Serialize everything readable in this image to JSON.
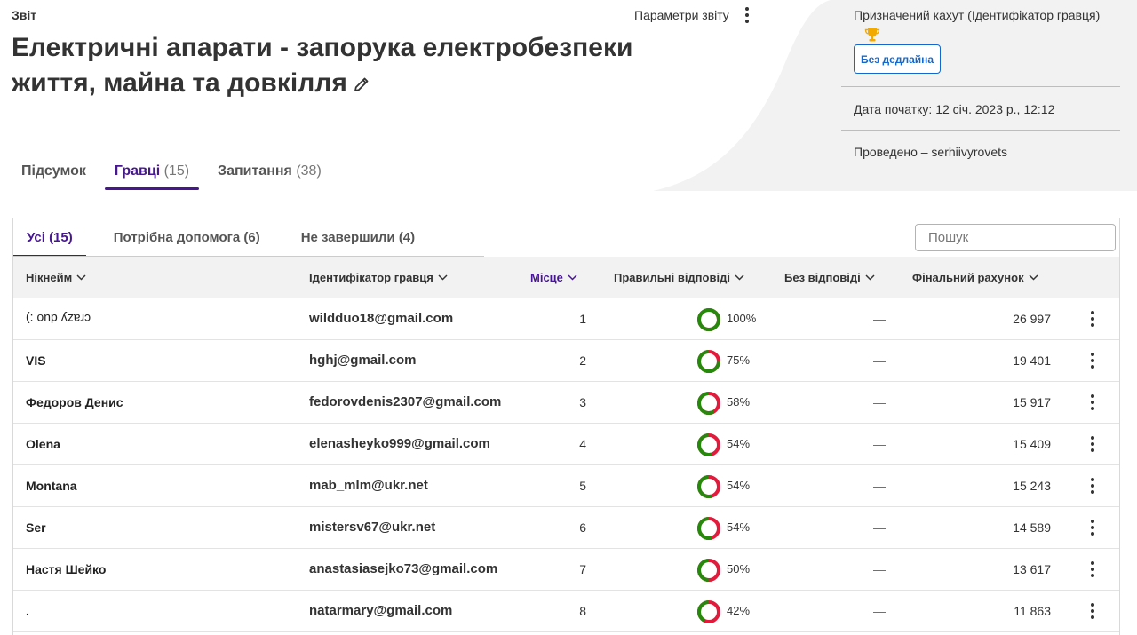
{
  "header": {
    "report_label": "Звіт",
    "title": "Електричні апарати - запорука електробезпеки життя, майна та довкілля",
    "report_options": "Параметри звіту"
  },
  "side_panel": {
    "assigned_kahoot": "Призначений кахут  (Ідентифікатор гравця)",
    "deadline_button": "Без дедлайна",
    "start_date": "Дата початку: 12 січ. 2023 р., 12:12",
    "hosted_by": "Проведено – serhiivyrovets"
  },
  "tabs": [
    {
      "label": "Підсумок",
      "count": ""
    },
    {
      "label": "Гравці",
      "count": "(15)"
    },
    {
      "label": "Запитання",
      "count": "(38)"
    }
  ],
  "subtabs": [
    {
      "label": "Усі (15)"
    },
    {
      "label": "Потрібна допомога (6)"
    },
    {
      "label": "Не завершили (4)"
    }
  ],
  "search": {
    "placeholder": "Пошук"
  },
  "columns": {
    "nickname": "Нікнейм",
    "player_id": "Ідентифікатор гравця",
    "place": "Місце",
    "correct": "Правильні відповіді",
    "no_answer": "Без відповіді",
    "final_score": "Фінальний рахунок"
  },
  "players": [
    {
      "nickname": "crazy duo :)",
      "email": "wildduo18@gmail.com",
      "place": "1",
      "correct": "100%",
      "correct_value": 100,
      "no_answer": "—",
      "score": "26 997"
    },
    {
      "nickname": "VIS",
      "email": "hghj@gmail.com",
      "place": "2",
      "correct": "75%",
      "correct_value": 75,
      "no_answer": "—",
      "score": "19 401"
    },
    {
      "nickname": "Федоров Денис",
      "email": "fedorovdenis2307@gmail.com",
      "place": "3",
      "correct": "58%",
      "correct_value": 58,
      "no_answer": "—",
      "score": "15 917"
    },
    {
      "nickname": "Olena",
      "email": "elenasheyko999@gmail.com",
      "place": "4",
      "correct": "54%",
      "correct_value": 54,
      "no_answer": "—",
      "score": "15 409"
    },
    {
      "nickname": "Montana",
      "email": "mab_mlm@ukr.net",
      "place": "5",
      "correct": "54%",
      "correct_value": 54,
      "no_answer": "—",
      "score": "15 243"
    },
    {
      "nickname": "Ser",
      "email": "mistersv67@ukr.net",
      "place": "6",
      "correct": "54%",
      "correct_value": 54,
      "no_answer": "—",
      "score": "14 589"
    },
    {
      "nickname": "Настя Шейко",
      "email": "anastasiasejko73@gmail.com",
      "place": "7",
      "correct": "50%",
      "correct_value": 50,
      "no_answer": "—",
      "score": "13 617"
    },
    {
      "nickname": ".",
      "email": "natarmary@gmail.com",
      "place": "8",
      "correct": "42%",
      "correct_value": 42,
      "no_answer": "—",
      "score": "11 863"
    }
  ],
  "colors": {
    "accent": "#46178f",
    "link_blue": "#1368ce",
    "correct_green": "#26890c",
    "incorrect_red": "#e21b3c",
    "header_bg": "#f2f2f2"
  }
}
